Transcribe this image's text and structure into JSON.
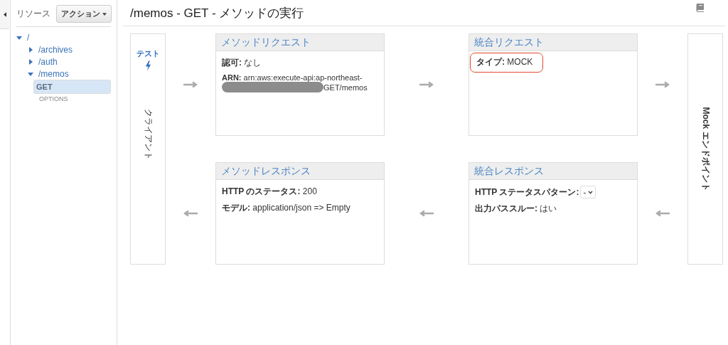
{
  "sidebar": {
    "title": "リソース",
    "action_button": "アクション",
    "tree": [
      {
        "label": "/",
        "kind": "resource",
        "expanded": true,
        "children": [
          {
            "label": "/archives",
            "kind": "resource",
            "expanded": false
          },
          {
            "label": "/auth",
            "kind": "resource",
            "expanded": false
          },
          {
            "label": "/memos",
            "kind": "resource",
            "expanded": true,
            "children": [
              {
                "label": "GET",
                "kind": "method",
                "selected": true
              },
              {
                "label": "OPTIONS",
                "kind": "method",
                "selected": false
              }
            ]
          }
        ]
      }
    ]
  },
  "main": {
    "title": "/memos - GET - メソッドの実行",
    "client": {
      "test_label": "テスト",
      "label": "クライアント"
    },
    "method_request": {
      "title": "メソッドリクエスト",
      "fields": [
        {
          "kind": "text",
          "label": "認可:",
          "value": "なし"
        },
        {
          "kind": "redacted",
          "label": "ARN:",
          "value": "arn:aws:execute-api:ap-northeast-",
          "tail": "GET/memos"
        }
      ]
    },
    "integration_request": {
      "title": "統合リクエスト",
      "fields": [
        {
          "kind": "text",
          "label": "タイプ:",
          "value": "MOCK",
          "highlighted": true
        }
      ]
    },
    "endpoint": {
      "label": "Mock エンドポイント"
    },
    "method_response": {
      "title": "メソッドレスポンス",
      "fields": [
        {
          "kind": "text",
          "label": "HTTP のステータス:",
          "value": "200"
        },
        {
          "kind": "text",
          "label": "モデル:",
          "value": "application/json => Empty"
        }
      ]
    },
    "integration_response": {
      "title": "統合レスポンス",
      "fields": [
        {
          "kind": "select",
          "label": "HTTP ステータスパターン:",
          "value": "-"
        },
        {
          "kind": "text",
          "label": "出力パススルー:",
          "value": "はい"
        }
      ]
    }
  }
}
